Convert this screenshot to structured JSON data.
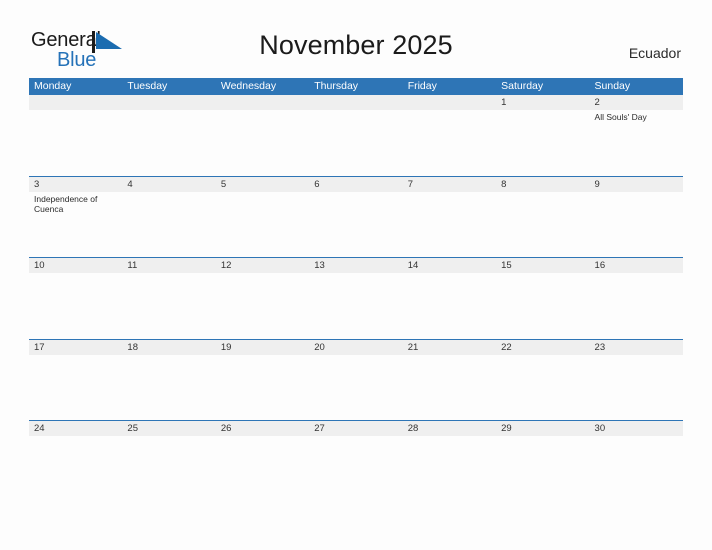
{
  "branding": {
    "name_part1": "General",
    "name_part2": "Blue",
    "flag_icon": "blue-triangle-flag-icon",
    "accent_color": "#2572b8"
  },
  "header": {
    "title": "November 2025",
    "country": "Ecuador"
  },
  "calendar": {
    "header_color": "#2e75b6",
    "band_color": "#efefef",
    "weekday_headers": [
      "Monday",
      "Tuesday",
      "Wednesday",
      "Thursday",
      "Friday",
      "Saturday",
      "Sunday"
    ],
    "weeks": [
      {
        "days": [
          {
            "num": "",
            "events": []
          },
          {
            "num": "",
            "events": []
          },
          {
            "num": "",
            "events": []
          },
          {
            "num": "",
            "events": []
          },
          {
            "num": "",
            "events": []
          },
          {
            "num": "1",
            "events": []
          },
          {
            "num": "2",
            "events": [
              "All Souls' Day"
            ]
          }
        ]
      },
      {
        "days": [
          {
            "num": "3",
            "events": [
              "Independence of Cuenca"
            ]
          },
          {
            "num": "4",
            "events": []
          },
          {
            "num": "5",
            "events": []
          },
          {
            "num": "6",
            "events": []
          },
          {
            "num": "7",
            "events": []
          },
          {
            "num": "8",
            "events": []
          },
          {
            "num": "9",
            "events": []
          }
        ]
      },
      {
        "days": [
          {
            "num": "10",
            "events": []
          },
          {
            "num": "11",
            "events": []
          },
          {
            "num": "12",
            "events": []
          },
          {
            "num": "13",
            "events": []
          },
          {
            "num": "14",
            "events": []
          },
          {
            "num": "15",
            "events": []
          },
          {
            "num": "16",
            "events": []
          }
        ]
      },
      {
        "days": [
          {
            "num": "17",
            "events": []
          },
          {
            "num": "18",
            "events": []
          },
          {
            "num": "19",
            "events": []
          },
          {
            "num": "20",
            "events": []
          },
          {
            "num": "21",
            "events": []
          },
          {
            "num": "22",
            "events": []
          },
          {
            "num": "23",
            "events": []
          }
        ]
      },
      {
        "days": [
          {
            "num": "24",
            "events": []
          },
          {
            "num": "25",
            "events": []
          },
          {
            "num": "26",
            "events": []
          },
          {
            "num": "27",
            "events": []
          },
          {
            "num": "28",
            "events": []
          },
          {
            "num": "29",
            "events": []
          },
          {
            "num": "30",
            "events": []
          }
        ]
      }
    ]
  }
}
